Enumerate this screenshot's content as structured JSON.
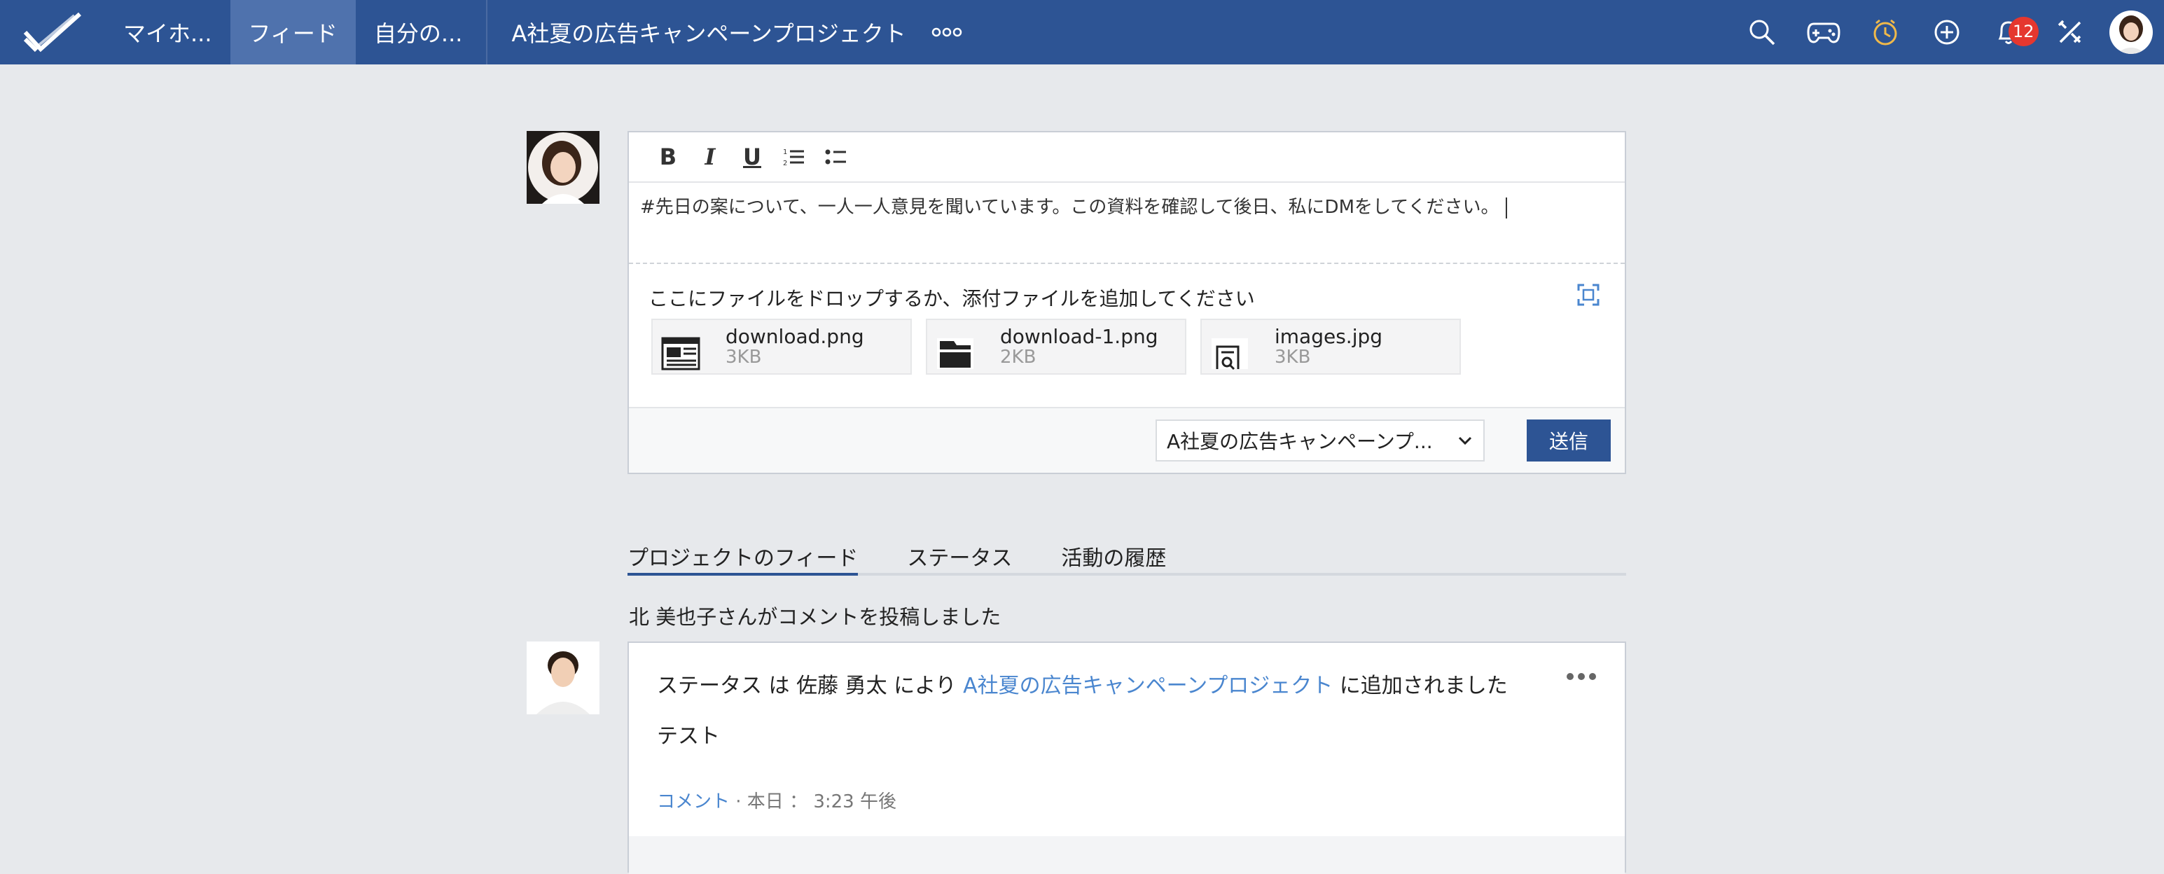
{
  "nav": {
    "items": [
      {
        "label": "マイホ..."
      },
      {
        "label": "フィード"
      },
      {
        "label": "自分の..."
      }
    ],
    "project_title": "A社夏の広告キャンペーンプロジェクト",
    "notification_count": "12"
  },
  "colors": {
    "nav_bg": "#2d5494",
    "nav_active": "#4f72ad",
    "link": "#4a86cf",
    "badge": "#e5372f"
  },
  "composer": {
    "text": "#先日の案について、一人一人意見を聞いています。この資料を確認して後日、私にDMをしてください。",
    "drop_hint": "ここにファイルをドロップするか、添付ファイルを追加してください",
    "files": [
      {
        "name": "download.png",
        "size": "3KB"
      },
      {
        "name": "download-1.png",
        "size": "2KB"
      },
      {
        "name": "images.jpg",
        "size": "3KB"
      }
    ],
    "project_select": "A社夏の広告キャンペーンプ...",
    "send_label": "送信"
  },
  "tabs": [
    {
      "label": "プロジェクトのフィード"
    },
    {
      "label": "ステータス"
    },
    {
      "label": "活動の履歴"
    }
  ],
  "feed": {
    "heading": "北 美也子さんがコメントを投稿しました",
    "post": {
      "line_prefix": "ステータス は 佐藤 勇太 により",
      "line_link": "A社夏の広告キャンペーンプロジェクト",
      "line_suffix": "に追加されました",
      "body": "テスト",
      "comment_label": "コメント",
      "meta_time": "· 本日 ： 3:23 午後"
    }
  }
}
